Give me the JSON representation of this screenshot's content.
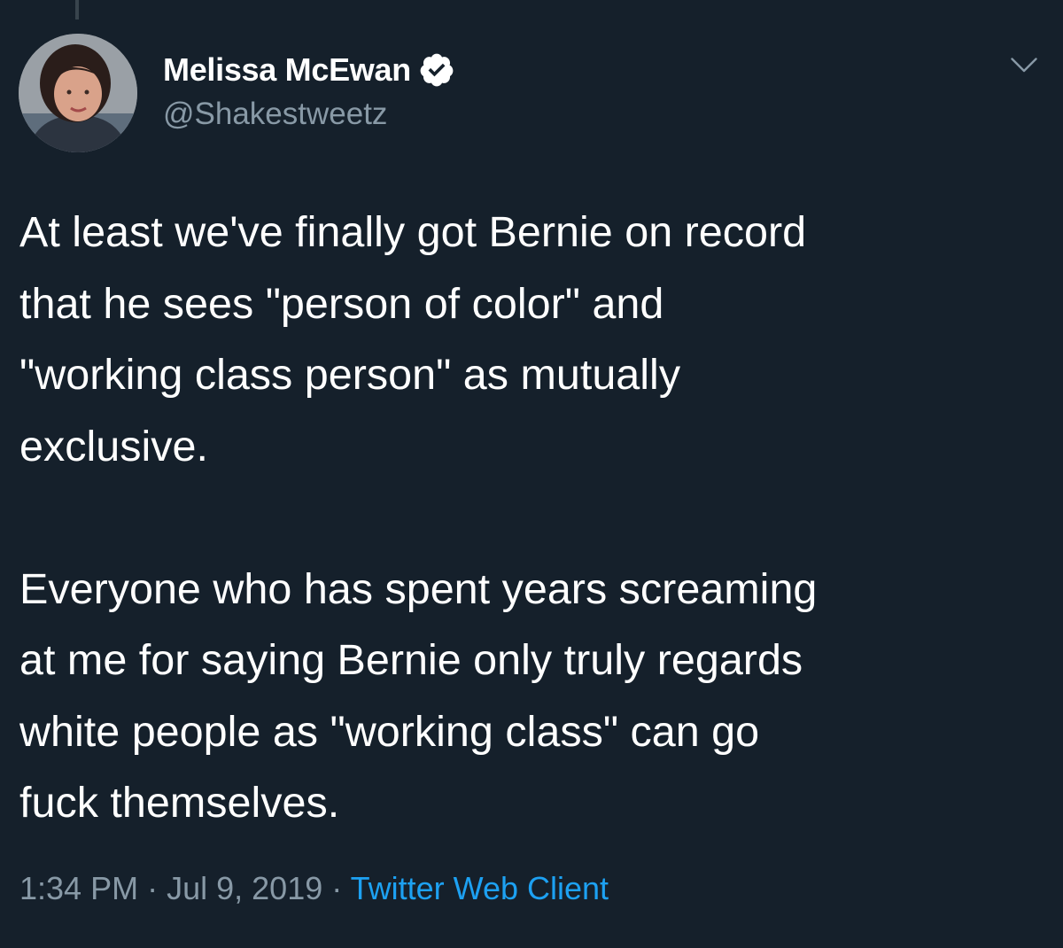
{
  "author": {
    "display_name": "Melissa McEwan",
    "handle": "@Shakestweetz",
    "verified": true
  },
  "icons": {
    "verified": "verified-badge-icon",
    "menu": "chevron-down-icon"
  },
  "tweet": {
    "paragraphs": [
      "At least we've finally got Bernie on record\nthat he sees \"person of color\" and\n\"working class person\" as mutually\nexclusive.",
      "Everyone who has spent years screaming\nat me for saying Bernie only truly regards\nwhite people as \"working class\" can go\nfuck themselves."
    ]
  },
  "meta": {
    "time": "1:34 PM",
    "separator": "·",
    "date": "Jul 9, 2019",
    "client": "Twitter Web Client"
  },
  "colors": {
    "background": "#15202b",
    "text": "#ffffff",
    "secondary": "#8899a6",
    "link": "#1da1f2"
  }
}
